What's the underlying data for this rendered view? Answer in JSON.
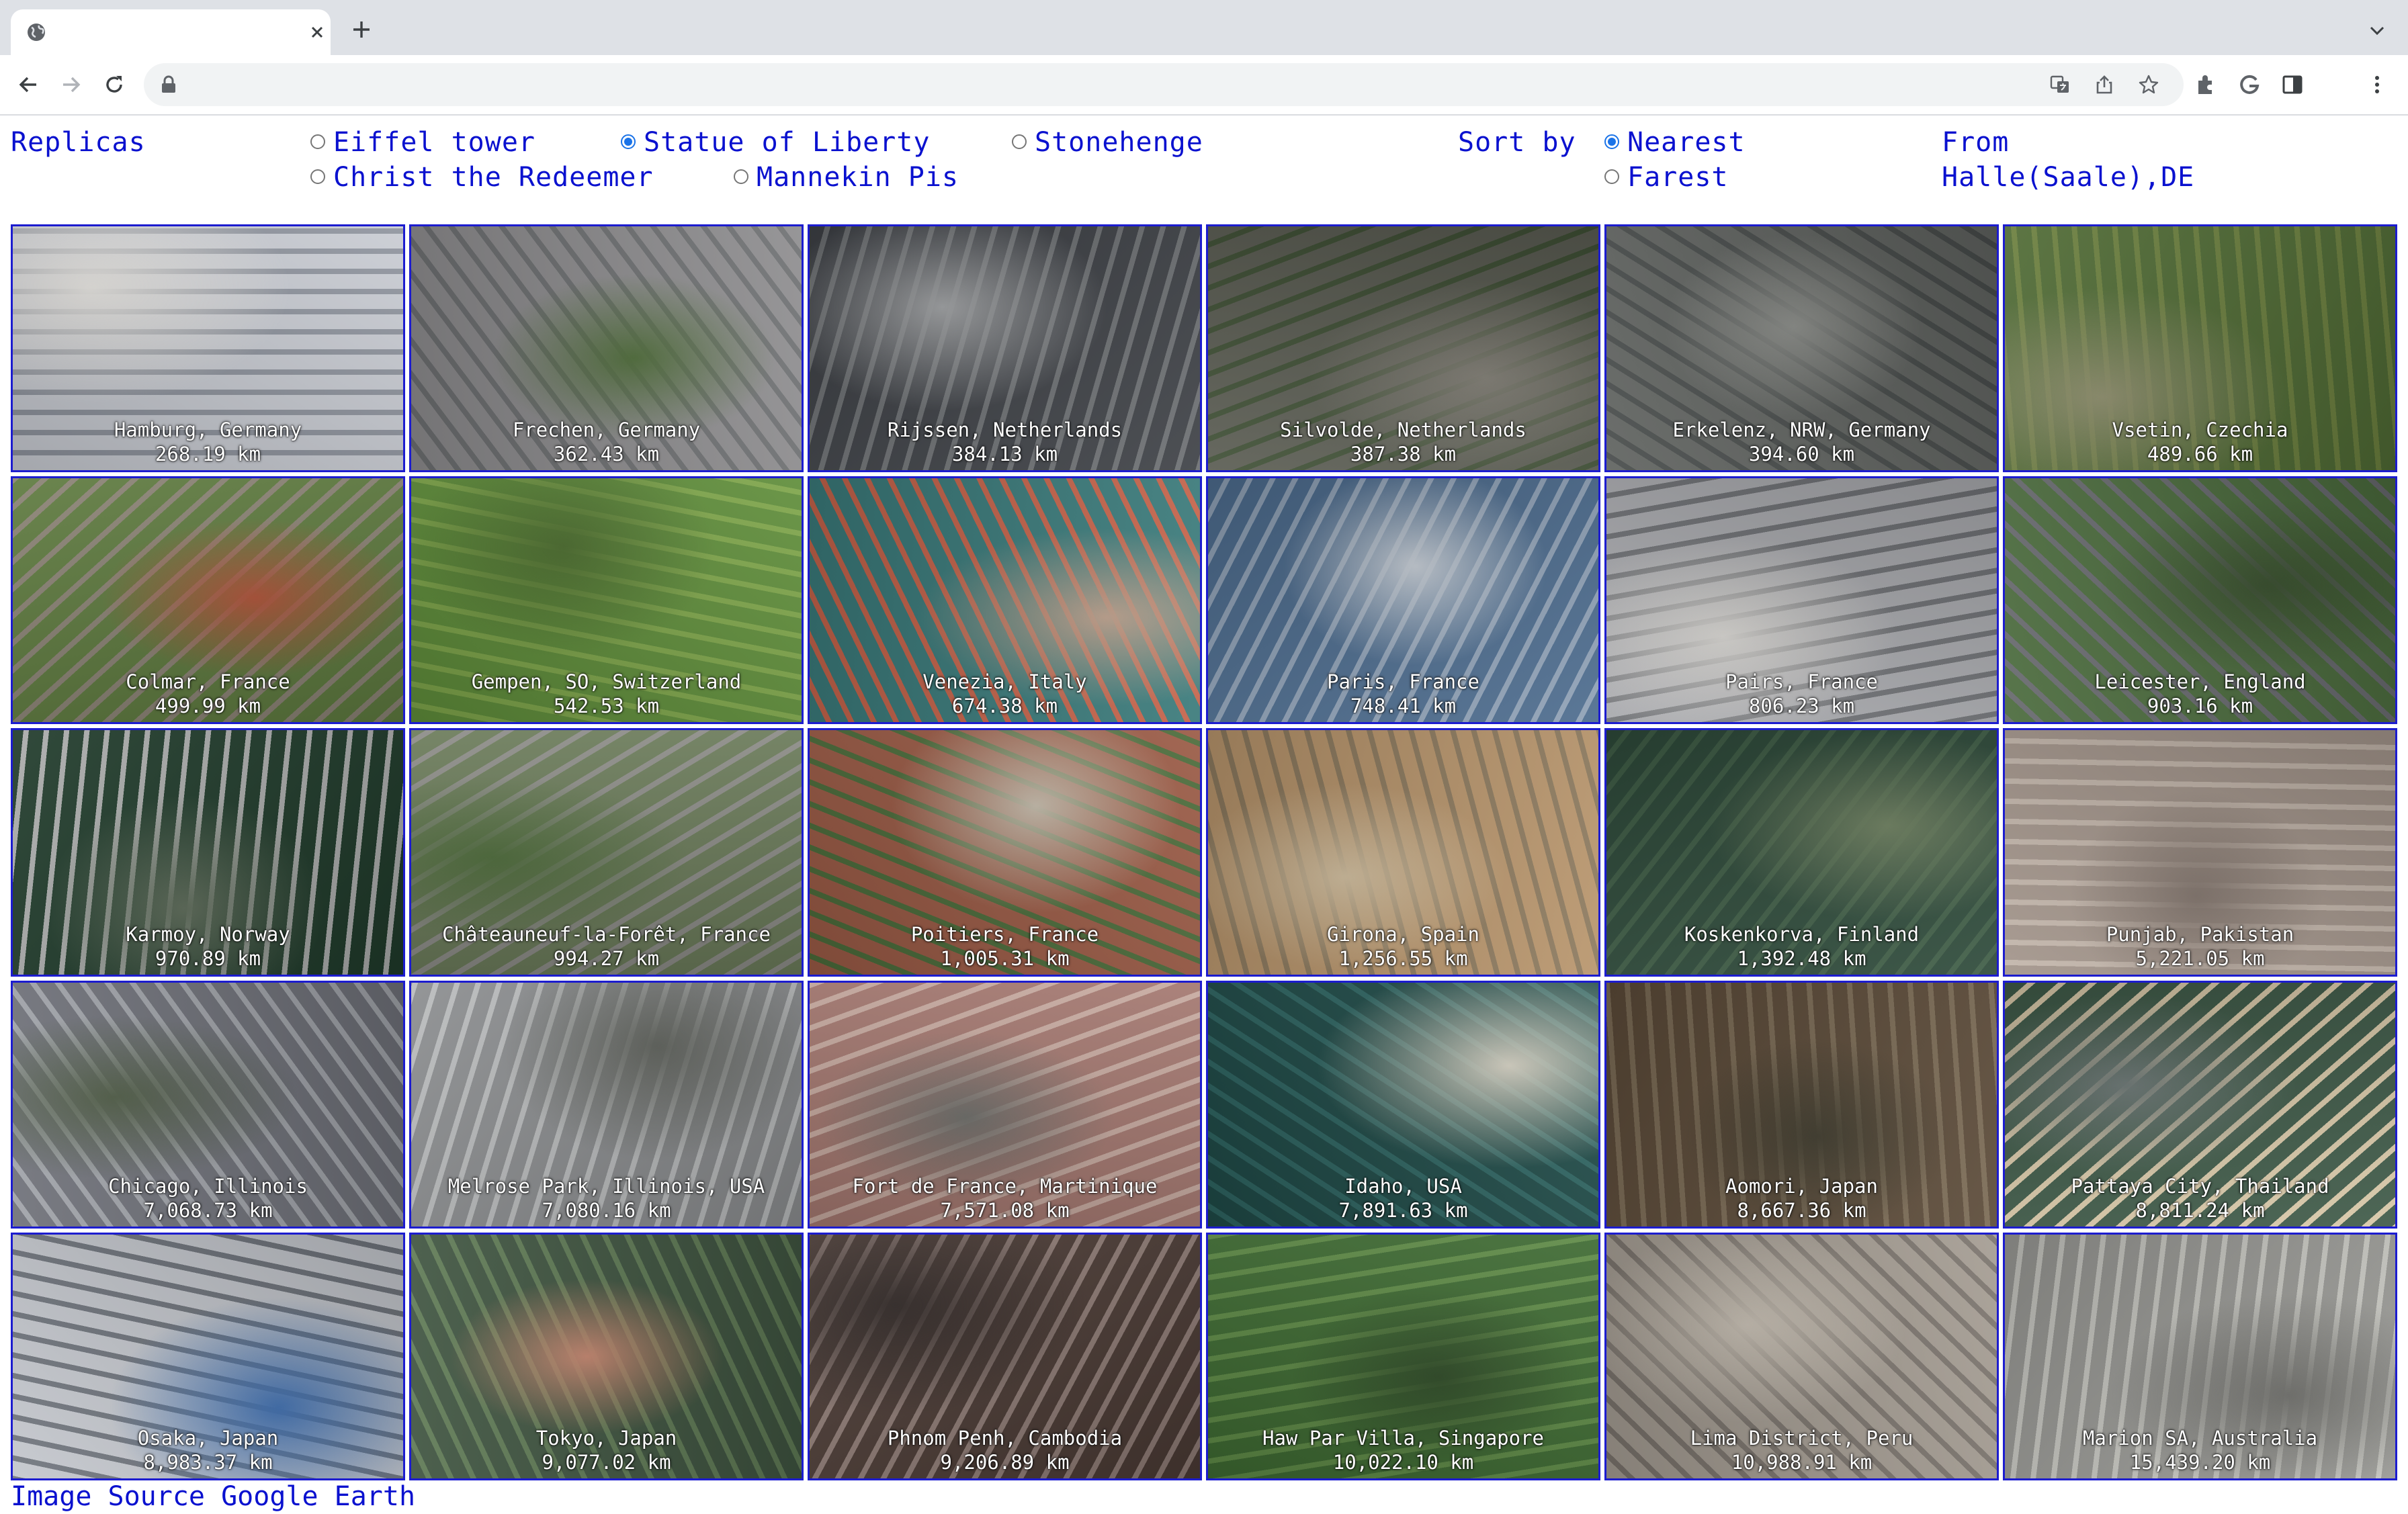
{
  "browser": {
    "tab_title": "",
    "address": ""
  },
  "controls": {
    "replicas_label": "Replicas",
    "replica_options": [
      {
        "label": "Eiffel tower",
        "selected": false
      },
      {
        "label": "Statue of Liberty",
        "selected": true
      },
      {
        "label": "Stonehenge",
        "selected": false
      },
      {
        "label": "Christ the Redeemer",
        "selected": false
      },
      {
        "label": "Mannekin Pis",
        "selected": false
      }
    ],
    "sort_label": "Sort by",
    "sort_options": [
      {
        "label": "Nearest",
        "selected": true
      },
      {
        "label": "Farest",
        "selected": false
      }
    ],
    "from_label": "From",
    "from_value": "Halle(Saale),DE"
  },
  "results": [
    {
      "place": "Hamburg, Germany",
      "distance": "268.19 km",
      "palette": [
        "#c9ccd3",
        "#8f949e",
        "#e8e6e2"
      ]
    },
    {
      "place": "Frechen, Germany",
      "distance": "362.43 km",
      "palette": [
        "#8e8d8f",
        "#6f7173",
        "#4f6d3a"
      ]
    },
    {
      "place": "Rijssen, Netherlands",
      "distance": "384.13 km",
      "palette": [
        "#3e4146",
        "#6c6f72",
        "#a6a8aa"
      ]
    },
    {
      "place": "Silvolde, Netherlands",
      "distance": "387.38 km",
      "palette": [
        "#5a5c52",
        "#3f4f35",
        "#807d74"
      ]
    },
    {
      "place": "Erkelenz, NRW, Germany",
      "distance": "394.60 km",
      "palette": [
        "#5f625f",
        "#474b4a",
        "#8a8c88"
      ]
    },
    {
      "place": "Vsetin, Czechia",
      "distance": "489.66 km",
      "palette": [
        "#4f6a34",
        "#6b7f3e",
        "#8b8b6a"
      ]
    },
    {
      "place": "Colmar, France",
      "distance": "499.99 km",
      "palette": [
        "#5e7a3f",
        "#8a8274",
        "#b05238"
      ]
    },
    {
      "place": "Gempen, SO, Switzerland",
      "distance": "542.53 km",
      "palette": [
        "#5f8d3a",
        "#7ea54a",
        "#4a6b2d"
      ]
    },
    {
      "place": "Venezia, Italy",
      "distance": "674.38 km",
      "palette": [
        "#3a7a7a",
        "#c5634a",
        "#b89c88"
      ]
    },
    {
      "place": "Paris, France",
      "distance": "748.41 km",
      "palette": [
        "#4d6c8e",
        "#8fa1b6",
        "#c7ced6"
      ]
    },
    {
      "place": "Pairs, France",
      "distance": "806.23 km",
      "palette": [
        "#a8a9ad",
        "#6f7175",
        "#d2d0cc"
      ]
    },
    {
      "place": "Leicester, England",
      "distance": "903.16 km",
      "palette": [
        "#4a6a3c",
        "#66686c",
        "#39502e"
      ]
    },
    {
      "place": "Karmoy, Norway",
      "distance": "970.89 km",
      "palette": [
        "#1f3a2a",
        "#a9abaa",
        "#5c6a58"
      ]
    },
    {
      "place": "Châteauneuf-la-Forêt, France",
      "distance": "994.27 km",
      "palette": [
        "#6b7b5a",
        "#8c8c87",
        "#4d6b3a"
      ]
    },
    {
      "place": "Poitiers, France",
      "distance": "1,005.31 km",
      "palette": [
        "#9a5a45",
        "#4b6b3a",
        "#c2b8a8"
      ]
    },
    {
      "place": "Girona, Spain",
      "distance": "1,256.55 km",
      "palette": [
        "#b8956c",
        "#8d7a5e",
        "#d3c0a0"
      ]
    },
    {
      "place": "Koskenkorva, Finland",
      "distance": "1,392.48 km",
      "palette": [
        "#2e4a3a",
        "#3f5d46",
        "#6e8060"
      ]
    },
    {
      "place": "Punjab, Pakistan",
      "distance": "5,221.05 km",
      "palette": [
        "#a2948a",
        "#c2b5aa",
        "#7f726a"
      ]
    },
    {
      "place": "Chicago, Illinois",
      "distance": "7,068.73 km",
      "palette": [
        "#6e7078",
        "#9fa2a8",
        "#4d5a44"
      ]
    },
    {
      "place": "Melrose Park, Illinois, USA",
      "distance": "7,080.16 km",
      "palette": [
        "#8b8d8f",
        "#b9bbbc",
        "#5f625c"
      ]
    },
    {
      "place": "Fort de France, Martinique",
      "distance": "7,571.08 km",
      "palette": [
        "#a47870",
        "#c7aaa0",
        "#6e6e6a"
      ]
    },
    {
      "place": "Idaho, USA",
      "distance": "7,891.63 km",
      "palette": [
        "#1f4a47",
        "#2e6461",
        "#cfcbbd"
      ]
    },
    {
      "place": "Aomori, Japan",
      "distance": "8,667.36 km",
      "palette": [
        "#5b4a38",
        "#7a6a54",
        "#3e3a2c"
      ]
    },
    {
      "place": "Pattaya City, Thailand",
      "distance": "8,811.24 km",
      "palette": [
        "#3f5a48",
        "#d8c8a8",
        "#6f7a78"
      ]
    },
    {
      "place": "Osaka, Japan",
      "distance": "8,983.37 km",
      "palette": [
        "#c3c6cc",
        "#6f747c",
        "#3f6fb0"
      ]
    },
    {
      "place": "Tokyo, Japan",
      "distance": "9,077.02 km",
      "palette": [
        "#3f5440",
        "#5f7a55",
        "#c4856e"
      ]
    },
    {
      "place": "Phnom Penh, Cambodia",
      "distance": "9,206.89 km",
      "palette": [
        "#4a3a34",
        "#8d7a74",
        "#2e2624"
      ]
    },
    {
      "place": "Haw Par Villa, Singapore",
      "distance": "10,022.10 km",
      "palette": [
        "#3e6a32",
        "#5e8a46",
        "#2e4a26"
      ]
    },
    {
      "place": "Lima District, Peru",
      "distance": "10,988.91 km",
      "palette": [
        "#a49c92",
        "#7b746d",
        "#c8c0b4"
      ]
    },
    {
      "place": "Marion SA, Australia",
      "distance": "15,439.20 km",
      "palette": [
        "#9a9a96",
        "#c8c8c2",
        "#6c6c68"
      ]
    }
  ],
  "footer": {
    "source_text": "Image Source Google Earth"
  }
}
